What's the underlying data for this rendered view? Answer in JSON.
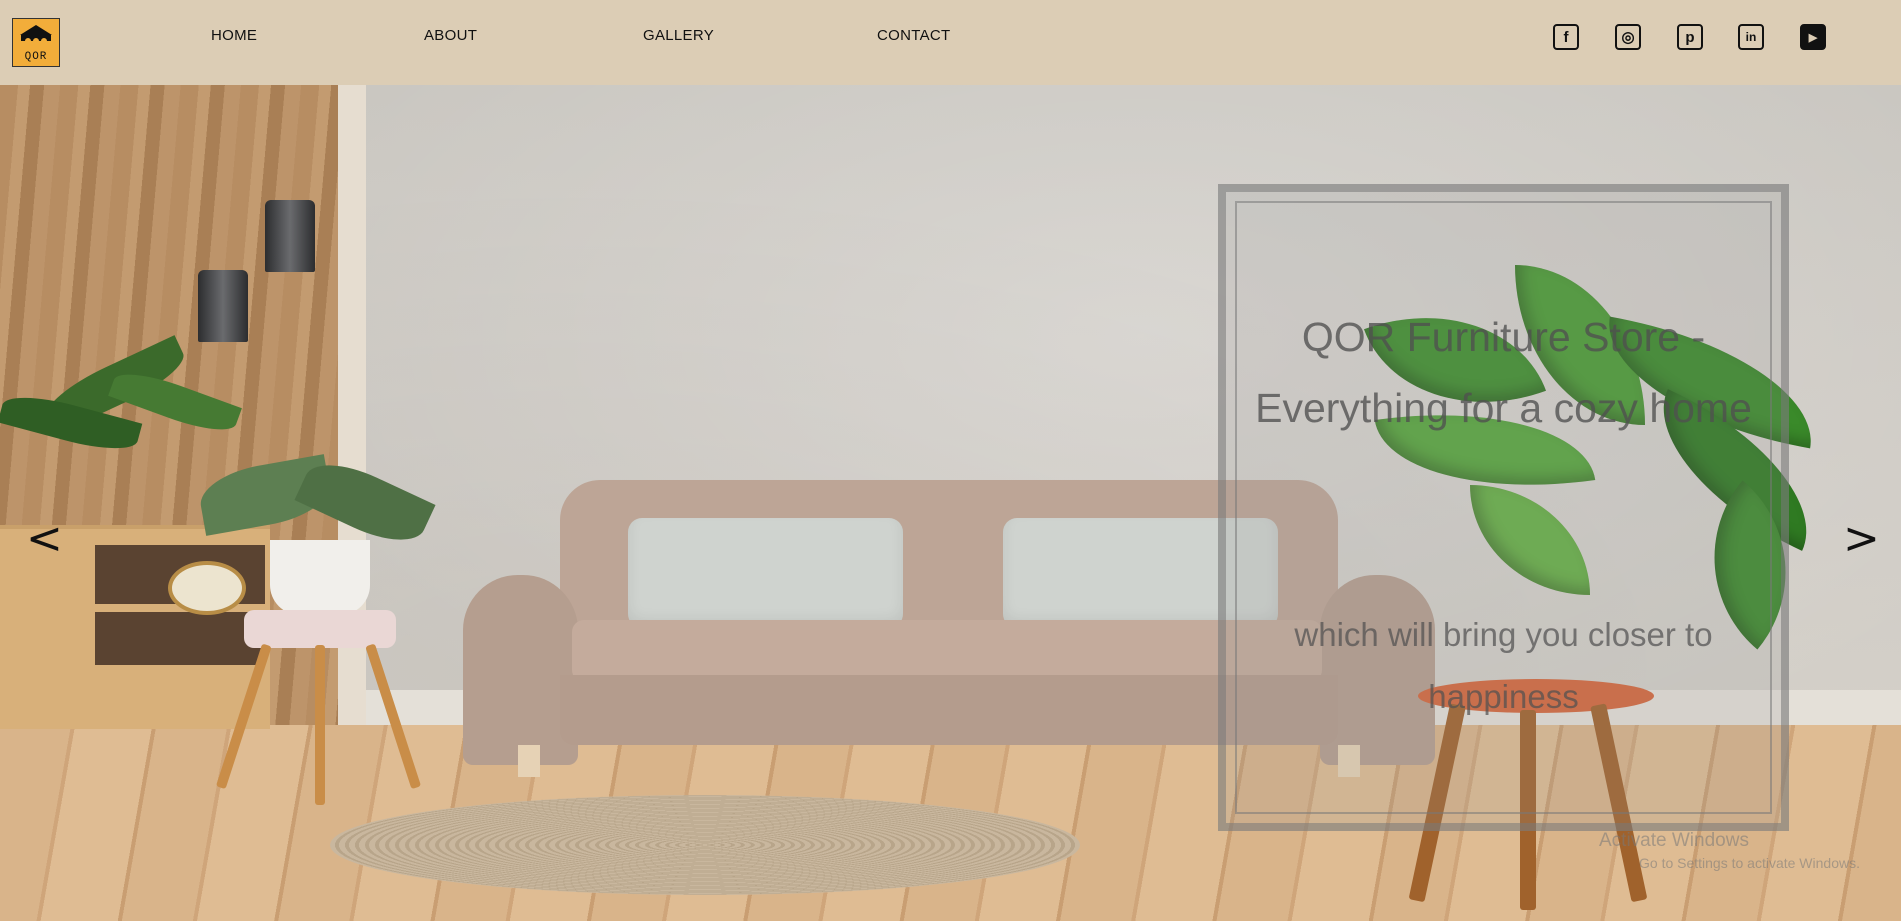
{
  "brand": {
    "logo_text": "QOR"
  },
  "nav": {
    "items": [
      {
        "label": "HOME"
      },
      {
        "label": "ABOUT"
      },
      {
        "label": "GALLERY"
      },
      {
        "label": "CONTACT"
      }
    ]
  },
  "social": [
    {
      "name": "facebook-icon",
      "glyph": "f"
    },
    {
      "name": "instagram-icon",
      "glyph": "◎"
    },
    {
      "name": "pinterest-icon",
      "glyph": "p"
    },
    {
      "name": "linkedin-icon",
      "glyph": "in"
    },
    {
      "name": "youtube-icon",
      "glyph": "▶"
    }
  ],
  "hero": {
    "title_line1": "QOR Furniture Store -",
    "title_line2": "Everything for a cozy home",
    "sub_line1": "which will bring you closer to",
    "sub_line2": "happiness",
    "prev_label": "<",
    "next_label": ">"
  },
  "watermark": {
    "line1": "Activate Windows",
    "line2": "Go to Settings to activate Windows."
  },
  "colors": {
    "header_bg": "#dccdb5",
    "logo_bg": "#f2ad3a"
  }
}
